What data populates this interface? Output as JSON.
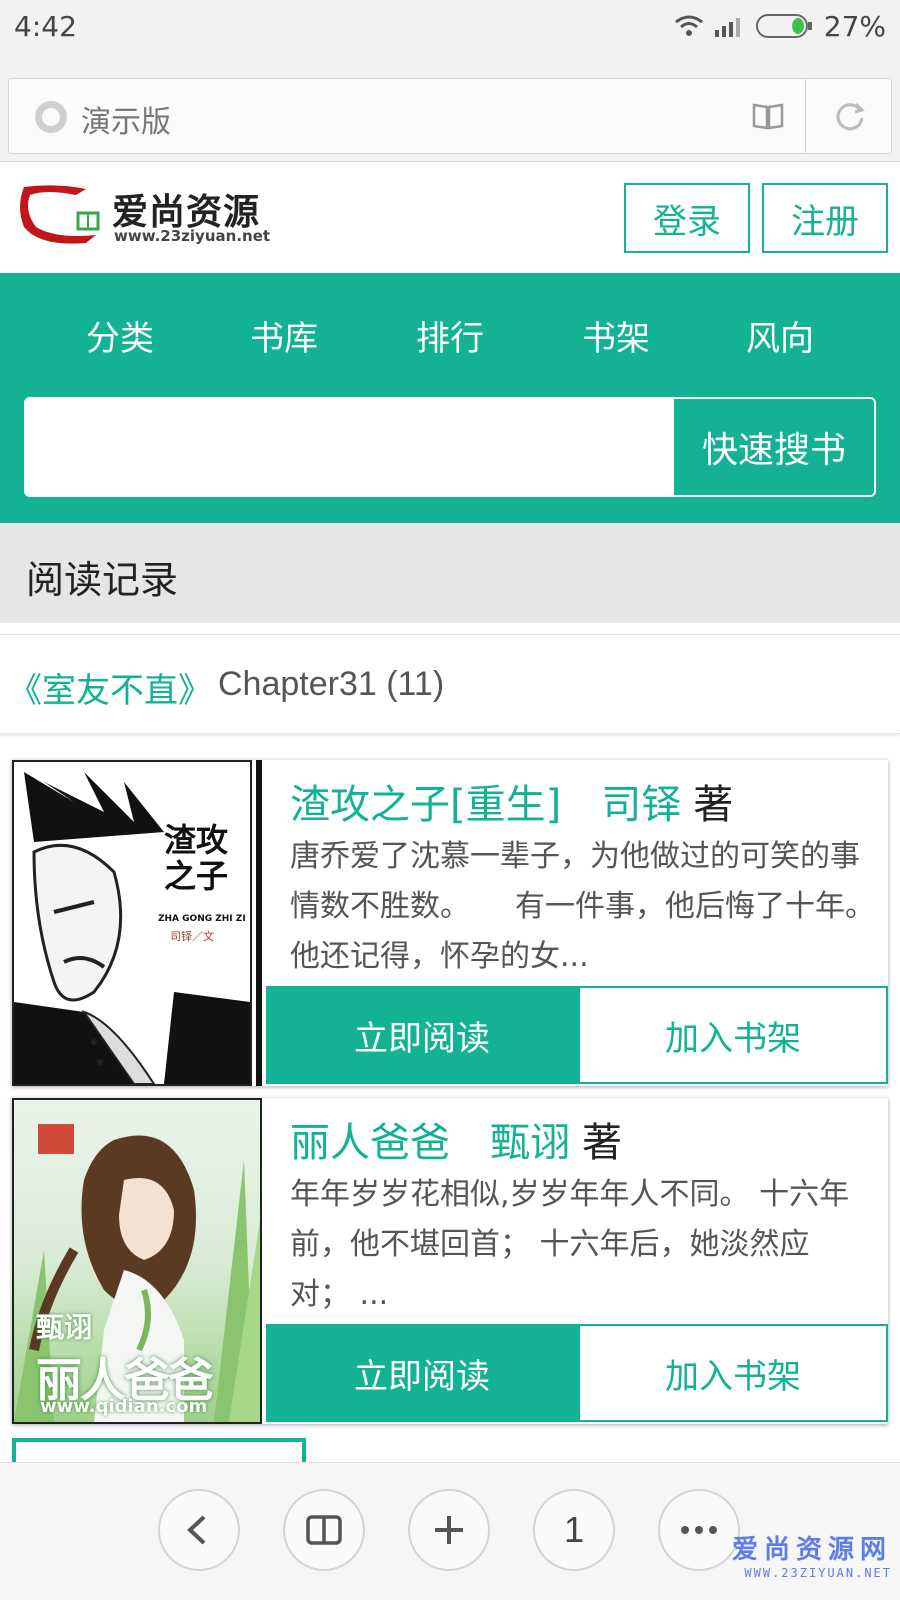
{
  "status_bar": {
    "time": "4:42",
    "battery_percent": "27%",
    "battery_level": 0.27,
    "icons": [
      "wifi-icon",
      "signal-icon",
      "battery-icon"
    ]
  },
  "browser": {
    "address_text": "演示版",
    "icons": [
      "site-icon",
      "reader-mode-icon",
      "reload-icon"
    ]
  },
  "site": {
    "logo_name": "爱尚资源",
    "logo_url": "www.23ziyuan.net",
    "login_label": "登录",
    "register_label": "注册"
  },
  "nav": {
    "items": [
      "分类",
      "书库",
      "排行",
      "书架",
      "风向"
    ]
  },
  "search": {
    "value": "",
    "button_label": "快速搜书"
  },
  "reading_record": {
    "title": "阅读记录",
    "book": "《室友不直》",
    "chapter": "Chapter31 (11)"
  },
  "books": [
    {
      "title": "渣攻之子[重生]",
      "author": "司铎",
      "author_suffix": "著",
      "description": "唐乔爱了沈慕一辈子，为他做过的可笑的事情数不胜数。　　有一件事，他后悔了十年。　　他还记得，怀孕的女...",
      "cover_text": "渣攻之子",
      "cover_pinyin": "ZHA GONG ZHI ZI",
      "cover_author": "司铎／文",
      "read_label": "立即阅读",
      "shelf_label": "加入书架"
    },
    {
      "title": "丽人爸爸",
      "author": "甄诩",
      "author_suffix": "著",
      "description": "年年岁岁花相似,岁岁年年人不同。 十六年前，他不堪回首； 十六年后，她淡然应对； ...",
      "cover_text": "丽人爸爸",
      "cover_author": "甄诩",
      "cover_url": "www.qidian.com",
      "read_label": "立即阅读",
      "shelf_label": "加入书架"
    }
  ],
  "toolbar": {
    "tab_count": "1",
    "icons": [
      "back-icon",
      "bookmarks-icon",
      "add-icon",
      "tabs-button",
      "more-icon"
    ]
  },
  "watermark": {
    "name": "爱尚资源网",
    "url": "WWW.23ZIYUAN.NET"
  },
  "colors": {
    "accent": "#13b294",
    "status_bg": "#f2f2f2",
    "record_bg": "#e6e6e6"
  }
}
